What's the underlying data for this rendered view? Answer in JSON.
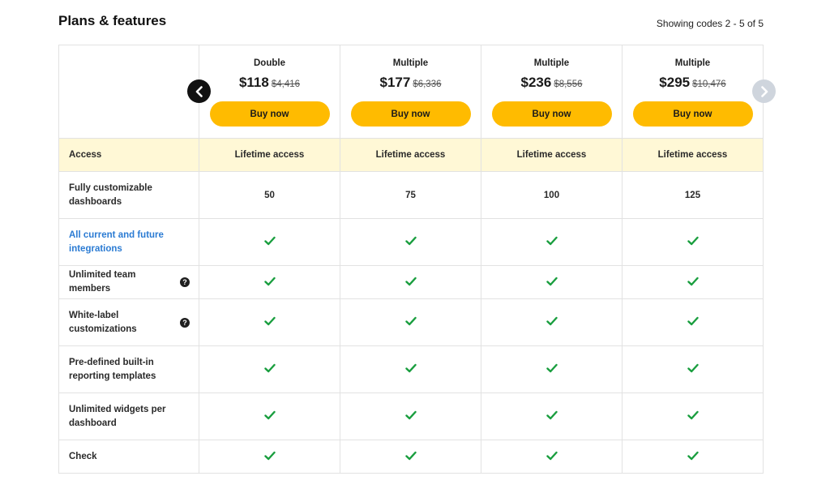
{
  "header": {
    "title": "Plans & features",
    "showing": "Showing codes 2 - 5 of 5"
  },
  "plans": [
    {
      "name": "Double",
      "price": "$118",
      "old_price": "$4,416",
      "button": "Buy now"
    },
    {
      "name": "Multiple",
      "price": "$177",
      "old_price": "$6,336",
      "button": "Buy now"
    },
    {
      "name": "Multiple",
      "price": "$236",
      "old_price": "$8,556",
      "button": "Buy now"
    },
    {
      "name": "Multiple",
      "price": "$295",
      "old_price": "$10,476",
      "button": "Buy now"
    }
  ],
  "access": {
    "label": "Access",
    "values": [
      "Lifetime access",
      "Lifetime access",
      "Lifetime access",
      "Lifetime access"
    ]
  },
  "features": [
    {
      "label": "Fully customizable dashboards",
      "values": [
        "50",
        "75",
        "100",
        "125"
      ]
    },
    {
      "label": "All current and future integrations",
      "is_link": true,
      "values": [
        "check",
        "check",
        "check",
        "check"
      ]
    },
    {
      "label": "Unlimited team members",
      "help_icon": "question-circle-icon",
      "values": [
        "check",
        "check",
        "check",
        "check"
      ]
    },
    {
      "label": "White-label customizations",
      "help_icon": "question-circle-icon",
      "values": [
        "check",
        "check",
        "check",
        "check"
      ]
    },
    {
      "label": "Pre-defined built-in reporting templates",
      "values": [
        "check",
        "check",
        "check",
        "check"
      ]
    },
    {
      "label": "Unlimited widgets per dashboard",
      "values": [
        "check",
        "check",
        "check",
        "check"
      ]
    },
    {
      "label": "Check",
      "values": [
        "check",
        "check",
        "check",
        "check"
      ]
    }
  ],
  "nav": {
    "prev_icon": "chevron-left-icon",
    "next_icon": "chevron-right-icon"
  },
  "colors": {
    "accent": "#ffbb00",
    "access_bg": "#fff8d6",
    "check": "#1a9e3f",
    "link": "#2b7bd3",
    "nav_prev_bg": "#111111",
    "nav_next_bg": "#cfd5dd"
  }
}
